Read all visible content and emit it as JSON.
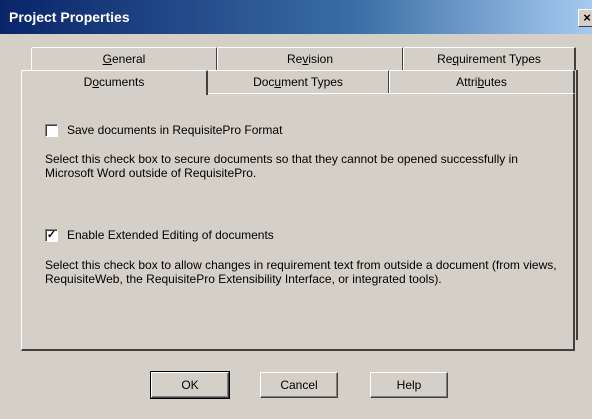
{
  "window": {
    "title": "Project Properties",
    "close_glyph": "×"
  },
  "tabs": {
    "back_row": [
      {
        "label": "General",
        "underline": "G"
      },
      {
        "label": "Revision",
        "underline": "v"
      },
      {
        "label": "Requirement Types",
        "underline": "q"
      }
    ],
    "front_row": [
      {
        "label": "Documents",
        "underline": "o",
        "active": true
      },
      {
        "label": "Document Types",
        "underline": "u"
      },
      {
        "label": "Attributes",
        "underline": "b"
      }
    ]
  },
  "options": [
    {
      "label": "Save documents in RequisitePro Format",
      "checked": false,
      "description": "Select this check box to secure documents so that they cannot be opened successfully in Microsoft Word outside of RequisitePro."
    },
    {
      "label": "Enable Extended Editing of documents",
      "checked": true,
      "description": "Select this check box to allow changes in requirement text from outside a document (from views, RequisiteWeb, the RequisitePro Extensibility Interface, or integrated tools)."
    }
  ],
  "buttons": {
    "ok": "OK",
    "cancel": "Cancel",
    "help": "Help"
  }
}
